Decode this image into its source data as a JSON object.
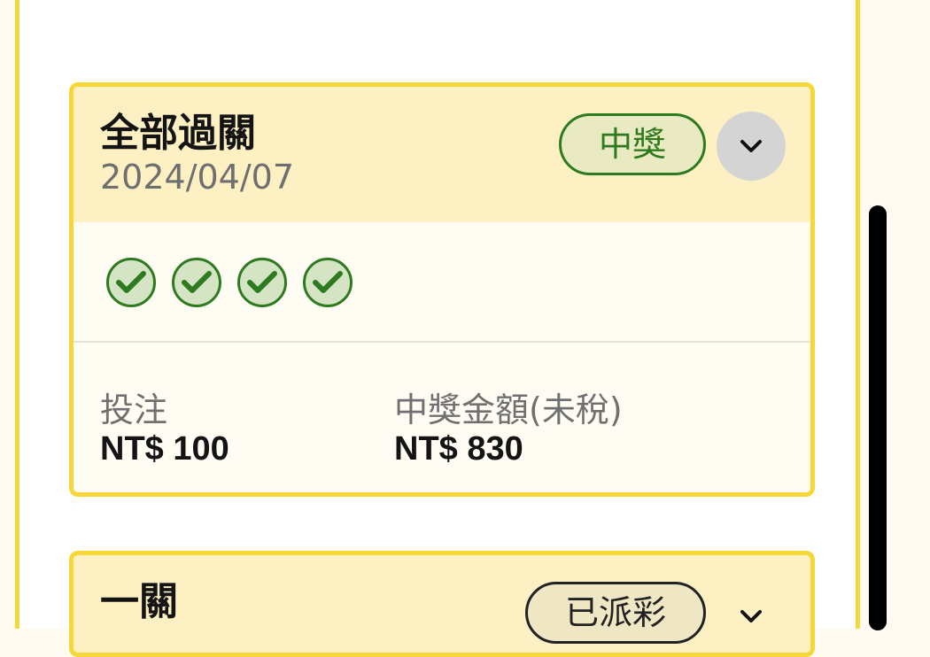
{
  "cards": [
    {
      "title": "全部過關",
      "date": "2024/04/07",
      "status": "中獎",
      "status_color": "#2e7a1f",
      "legs": [
        {
          "icon": "check-circle-icon",
          "result": "win"
        },
        {
          "icon": "check-circle-icon",
          "result": "win"
        },
        {
          "icon": "check-circle-icon",
          "result": "win"
        },
        {
          "icon": "check-circle-icon",
          "result": "win"
        }
      ],
      "stake_label": "投注",
      "stake_value": "NT$ 100",
      "payout_label": "中獎金額(未稅)",
      "payout_value": "NT$ 830",
      "expand_icon": "chevron-down-icon"
    },
    {
      "title": "一關",
      "status": "已派彩",
      "expand_icon": "chevron-down-icon"
    }
  ],
  "colors": {
    "card_border": "#f6d73a",
    "card_header": "#fdf1c3",
    "win_green": "#2e7a1f"
  }
}
